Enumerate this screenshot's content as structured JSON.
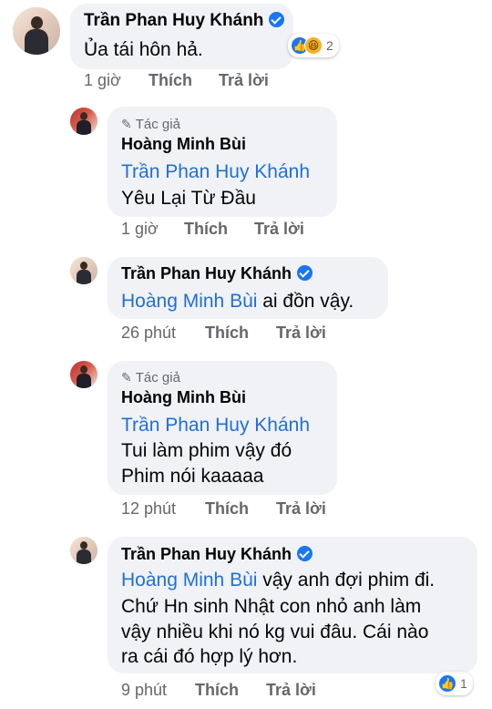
{
  "comments": [
    {
      "name": "Trần Phan Huy Khánh",
      "verified": true,
      "author": false,
      "lines": [
        "Ủa tái hôn hả."
      ],
      "time": "1 giờ",
      "like": "Thích",
      "reply": "Trả lời",
      "reactions": {
        "icons": [
          "like-icon",
          "haha-icon"
        ],
        "count": "2"
      }
    },
    {
      "name": "Hoàng Minh Bùi",
      "author": true,
      "author_label": "Tác giả",
      "mention": "Trần Phan Huy Khánh",
      "lines": [
        "Yêu Lại Từ Đầu"
      ],
      "time": "1 giờ",
      "like": "Thích",
      "reply": "Trả lời"
    },
    {
      "name": "Trần Phan Huy Khánh",
      "verified": true,
      "author": false,
      "mention": "Hoàng Minh Bùi",
      "mention_tail": " ai đồn vậy.",
      "time": "26 phút",
      "like": "Thích",
      "reply": "Trả lời"
    },
    {
      "name": "Hoàng Minh Bùi",
      "author": true,
      "author_label": "Tác giả",
      "mention": "Trần Phan Huy Khánh",
      "lines": [
        "Tui làm phim vậy đó",
        "Phim nói kaaaaa"
      ],
      "time": "12 phút",
      "like": "Thích",
      "reply": "Trả lời"
    },
    {
      "name": "Trần Phan Huy Khánh",
      "verified": true,
      "author": false,
      "mention": "Hoàng Minh Bùi",
      "mention_tail": " vậy anh đợi phim đi.",
      "lines": [
        "Chứ Hn sinh Nhật con nhỏ anh làm",
        "vậy nhiều khi nó kg vui đâu. Cái nào",
        "ra cái đó hợp lý hơn."
      ],
      "time": "9 phút",
      "like": "Thích",
      "reply": "Trả lời",
      "reactions": {
        "icons": [
          "like-icon"
        ],
        "count": "1"
      }
    }
  ],
  "colors": {
    "mention": "#216fdb",
    "bubble": "#f0f2f5",
    "meta": "#65676b",
    "verified": "#1877f2"
  }
}
